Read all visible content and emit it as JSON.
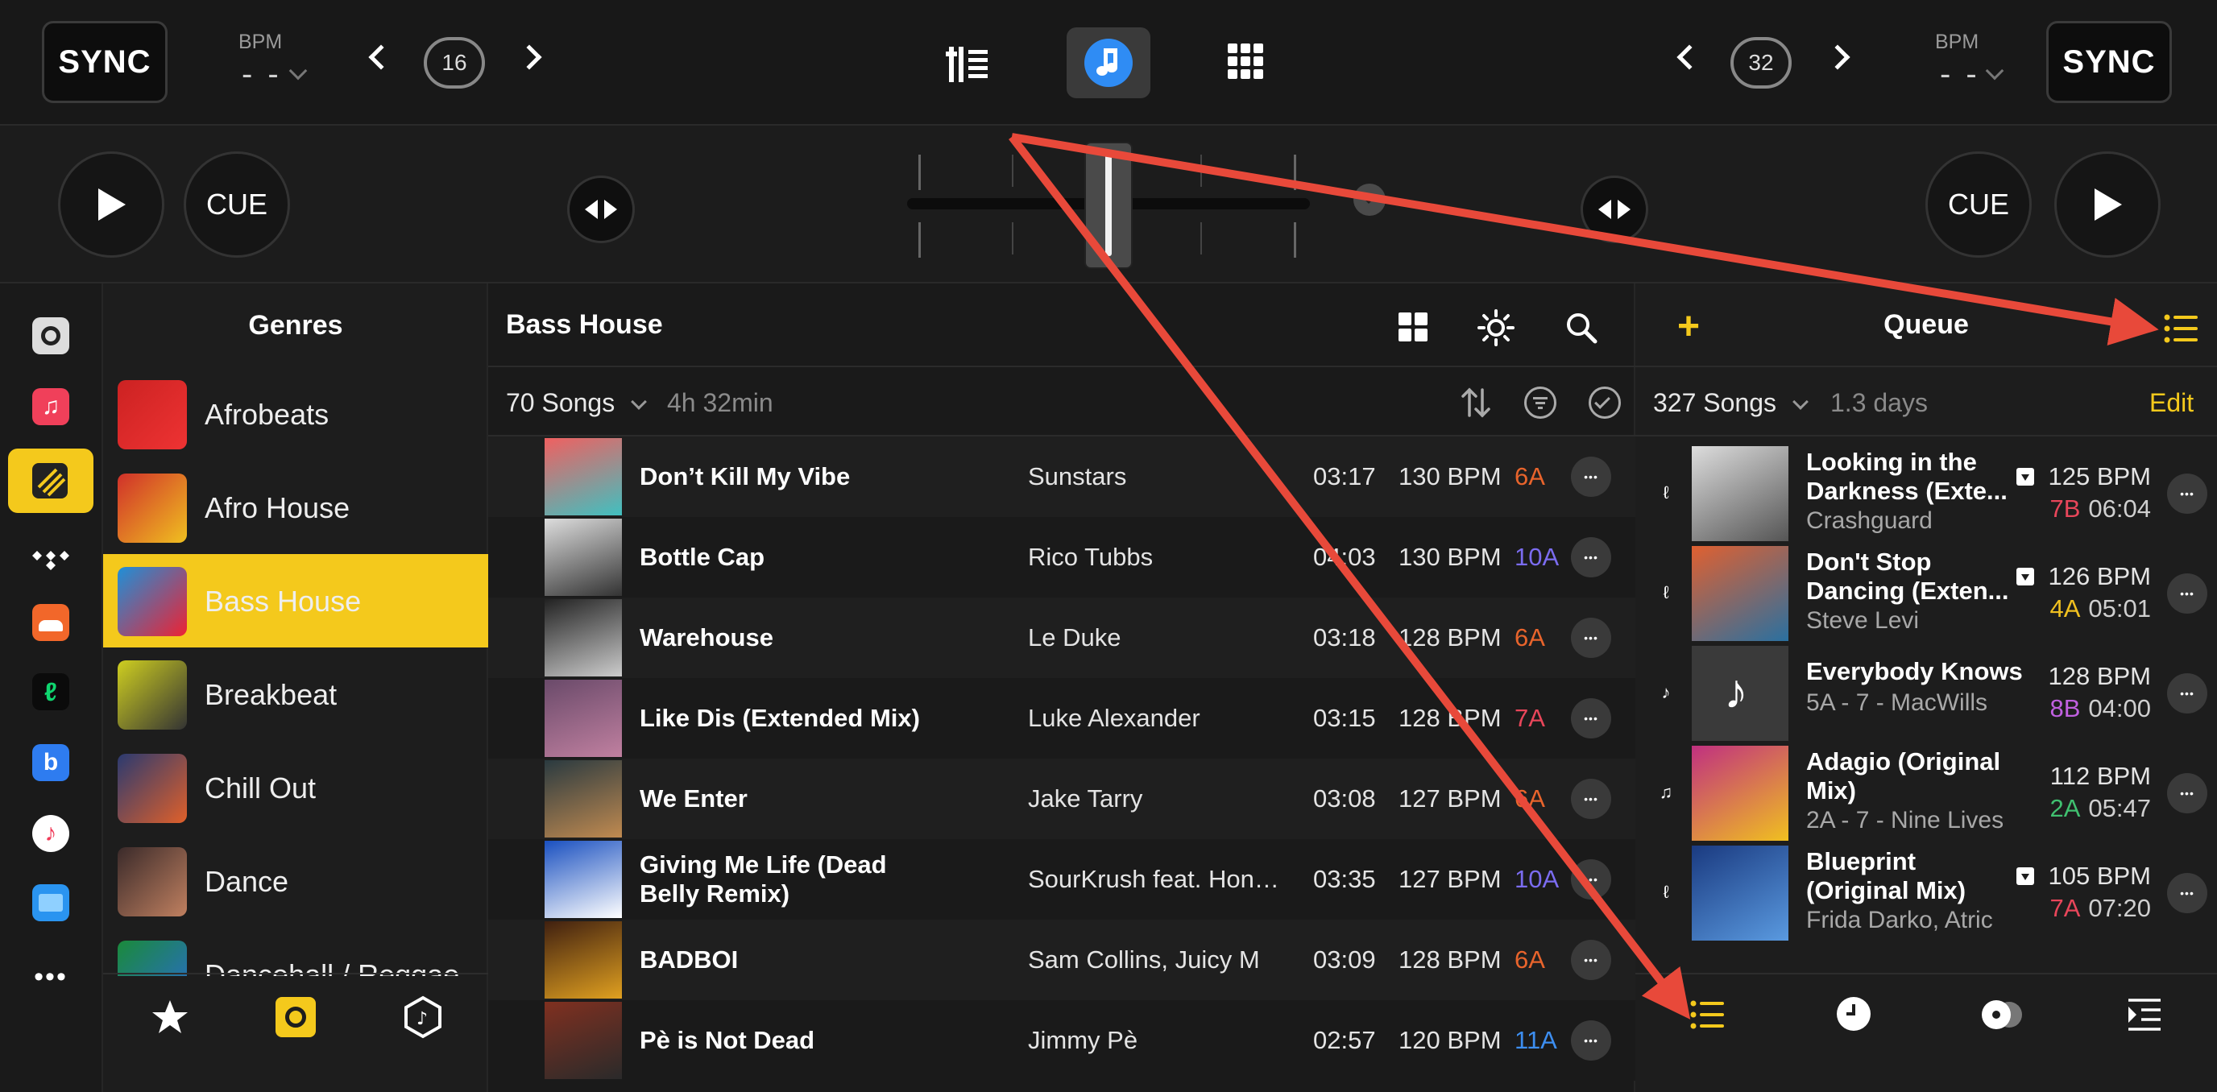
{
  "topbar": {
    "left_sync": "SYNC",
    "right_sync": "SYNC",
    "left_bpm_label": "BPM",
    "left_bpm_value": "- -",
    "right_bpm_label": "BPM",
    "right_bpm_value": "- -",
    "left_loop": "16",
    "right_loop": "32"
  },
  "transport": {
    "left_cue": "CUE",
    "right_cue": "CUE"
  },
  "genres": {
    "title": "Genres",
    "items": [
      {
        "label": "Afrobeats",
        "selected": false
      },
      {
        "label": "Afro House",
        "selected": false
      },
      {
        "label": "Bass House",
        "selected": true
      },
      {
        "label": "Breakbeat",
        "selected": false
      },
      {
        "label": "Chill Out",
        "selected": false
      },
      {
        "label": "Dance",
        "selected": false
      },
      {
        "label": "Dancehall / Reggae",
        "selected": false
      }
    ]
  },
  "songs": {
    "title": "Bass House",
    "count": "70 Songs",
    "duration": "4h 32min",
    "rows": [
      {
        "title": "Don’t Kill My Vibe",
        "artist": "Sunstars",
        "time": "03:17",
        "bpm": "130 BPM",
        "key": "6A",
        "key_color": "#e8642c"
      },
      {
        "title": "Bottle Cap",
        "artist": "Rico Tubbs",
        "time": "04:03",
        "bpm": "130 BPM",
        "key": "10A",
        "key_color": "#7b6cf0"
      },
      {
        "title": "Warehouse",
        "artist": "Le Duke",
        "time": "03:18",
        "bpm": "128 BPM",
        "key": "6A",
        "key_color": "#e8642c"
      },
      {
        "title": "Like Dis (Extended Mix)",
        "artist": "Luke Alexander",
        "time": "03:15",
        "bpm": "128 BPM",
        "key": "7A",
        "key_color": "#e8465a"
      },
      {
        "title": "We Enter",
        "artist": "Jake Tarry",
        "time": "03:08",
        "bpm": "127 BPM",
        "key": "6A",
        "key_color": "#e8642c"
      },
      {
        "title": "Giving Me Life (Dead Belly Remix)",
        "artist": "SourKrush feat. Hone...",
        "time": "03:35",
        "bpm": "127 BPM",
        "key": "10A",
        "key_color": "#7b6cf0"
      },
      {
        "title": "BADBOI",
        "artist": "Sam Collins, Juicy M",
        "time": "03:09",
        "bpm": "128 BPM",
        "key": "6A",
        "key_color": "#e8642c"
      },
      {
        "title": "Pè is Not Dead",
        "artist": "Jimmy Pè",
        "time": "02:57",
        "bpm": "120 BPM",
        "key": "11A",
        "key_color": "#3d8ef0"
      }
    ]
  },
  "queue": {
    "title": "Queue",
    "count": "327 Songs",
    "duration": "1.3 days",
    "edit": "Edit",
    "rows": [
      {
        "title": "Looking in the Darkness (Exte...",
        "sub": "Crashguard",
        "bpm": "125 BPM",
        "key": "7B",
        "time": "06:04",
        "key_color": "#e8465a",
        "download": true
      },
      {
        "title": "Don't Stop Dancing (Exten...",
        "sub": "Steve Levi",
        "bpm": "126 BPM",
        "key": "4A",
        "time": "05:01",
        "key_color": "#f0c020",
        "download": true
      },
      {
        "title": "Everybody Knows",
        "sub": "5A - 7 - MacWills",
        "bpm": "128 BPM",
        "key": "8B",
        "time": "04:00",
        "key_color": "#c060e0",
        "download": false
      },
      {
        "title": "Adagio (Original Mix)",
        "sub": "2A - 7 - Nine Lives",
        "bpm": "112 BPM",
        "key": "2A",
        "time": "05:47",
        "key_color": "#40c070",
        "download": false
      },
      {
        "title": "Blueprint (Original Mix)",
        "sub": "Frida Darko, Atric",
        "bpm": "105 BPM",
        "key": "7A",
        "time": "07:20",
        "key_color": "#e8465a",
        "download": true
      }
    ]
  },
  "icons": {
    "accent": "#f4c91c",
    "arrow": "#e8493a"
  }
}
